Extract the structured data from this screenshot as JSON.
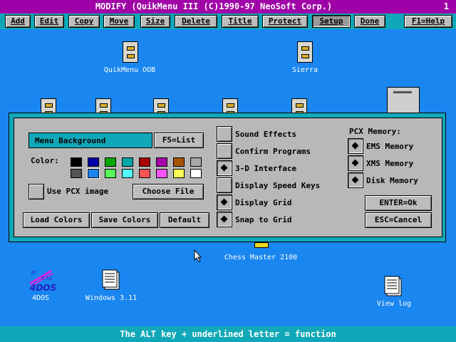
{
  "title": "MODIFY (QuikMenu III (C)1990-97 NeoSoft Corp.)",
  "title_number": "1",
  "menu": [
    "Add",
    "Edit",
    "Copy",
    "Move",
    "Size",
    "Delete",
    "Title",
    "Protect",
    "Setup",
    "Done",
    "F1=Help"
  ],
  "active_menu": "Setup",
  "desktop": {
    "quikmenu_label": "QuikMenu OOB",
    "sierra_label": "Sierra",
    "chess_label": "Chess Master 2100",
    "fourdos_label": "4DOS",
    "fourdos_logo": "4DOS",
    "fourdos_version": "5.52",
    "windows_label": "Windows 3.11",
    "viewlog_label": "View log"
  },
  "dialog": {
    "element_field": "Menu Background",
    "list_button": "F5=List",
    "color_label": "Color:",
    "colors_row1": [
      "#000000",
      "#0000a8",
      "#00a800",
      "#00a8a8",
      "#a80000",
      "#a800a8",
      "#a85400",
      "#a8a8a8"
    ],
    "colors_row2": [
      "#545454",
      "#1a86f0",
      "#54fc54",
      "#54fcfc",
      "#fc5454",
      "#fc54fc",
      "#fcfc54",
      "#ffffff"
    ],
    "use_pcx_label": "Use PCX image",
    "choose_file_button": "Choose File",
    "load_colors_button": "Load Colors",
    "save_colors_button": "Save Colors",
    "default_button": "Default",
    "options": [
      {
        "label": "Sound Effects",
        "checked": false
      },
      {
        "label": "Confirm Programs",
        "checked": false
      },
      {
        "label": "3-D Interface",
        "checked": true
      },
      {
        "label": "Display Speed Keys",
        "checked": false
      },
      {
        "label": "Display Grid",
        "checked": true
      },
      {
        "label": "Snap to Grid",
        "checked": true
      }
    ],
    "pcx_memory_label": "PCX Memory:",
    "memory_options": [
      {
        "label": "EMS Memory",
        "checked": true
      },
      {
        "label": "XMS Memory",
        "checked": true
      },
      {
        "label": "Disk Memory",
        "checked": true
      }
    ],
    "ok_button": "ENTER=Ok",
    "cancel_button": "ESC=Cancel"
  },
  "status": "The ALT key + underlined letter = function"
}
